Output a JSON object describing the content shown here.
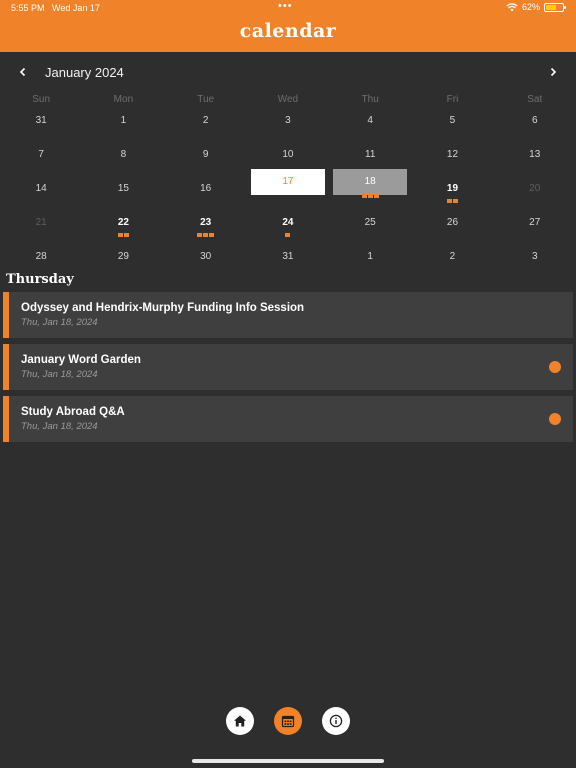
{
  "status": {
    "time": "5:55 PM",
    "date": "Wed Jan 17",
    "dots": "•••",
    "battery": "62%"
  },
  "app": {
    "title": "calendar"
  },
  "month_nav": {
    "label": "January 2024",
    "prev_icon": "chevron-left-icon",
    "next_icon": "chevron-right-icon"
  },
  "weekdays": [
    "Sun",
    "Mon",
    "Tue",
    "Wed",
    "Thu",
    "Fri",
    "Sat"
  ],
  "weeks": [
    [
      {
        "d": "31",
        "state": "normal",
        "dots": 0
      },
      {
        "d": "1",
        "state": "normal",
        "dots": 0
      },
      {
        "d": "2",
        "state": "normal",
        "dots": 0
      },
      {
        "d": "3",
        "state": "normal",
        "dots": 0
      },
      {
        "d": "4",
        "state": "normal",
        "dots": 0
      },
      {
        "d": "5",
        "state": "normal",
        "dots": 0
      },
      {
        "d": "6",
        "state": "normal",
        "dots": 0
      }
    ],
    [
      {
        "d": "7",
        "state": "normal",
        "dots": 0
      },
      {
        "d": "8",
        "state": "normal",
        "dots": 0
      },
      {
        "d": "9",
        "state": "normal",
        "dots": 0
      },
      {
        "d": "10",
        "state": "normal",
        "dots": 0
      },
      {
        "d": "11",
        "state": "normal",
        "dots": 0
      },
      {
        "d": "12",
        "state": "normal",
        "dots": 0
      },
      {
        "d": "13",
        "state": "normal",
        "dots": 0
      }
    ],
    [
      {
        "d": "14",
        "state": "normal",
        "dots": 0
      },
      {
        "d": "15",
        "state": "normal",
        "dots": 0
      },
      {
        "d": "16",
        "state": "normal",
        "dots": 0
      },
      {
        "d": "17",
        "state": "today",
        "dots": 0
      },
      {
        "d": "18",
        "state": "selected",
        "dots": 3
      },
      {
        "d": "19",
        "state": "bold",
        "dots": 2
      },
      {
        "d": "20",
        "state": "muted",
        "dots": 0
      }
    ],
    [
      {
        "d": "21",
        "state": "muted",
        "dots": 0
      },
      {
        "d": "22",
        "state": "bold",
        "dots": 2
      },
      {
        "d": "23",
        "state": "bold",
        "dots": 3
      },
      {
        "d": "24",
        "state": "bold",
        "dots": 1
      },
      {
        "d": "25",
        "state": "normal",
        "dots": 0
      },
      {
        "d": "26",
        "state": "normal",
        "dots": 0
      },
      {
        "d": "27",
        "state": "normal",
        "dots": 0
      }
    ],
    [
      {
        "d": "28",
        "state": "normal",
        "dots": 0
      },
      {
        "d": "29",
        "state": "normal",
        "dots": 0
      },
      {
        "d": "30",
        "state": "normal",
        "dots": 0
      },
      {
        "d": "31",
        "state": "normal",
        "dots": 0
      },
      {
        "d": "1",
        "state": "normal",
        "dots": 0
      },
      {
        "d": "2",
        "state": "normal",
        "dots": 0
      },
      {
        "d": "3",
        "state": "normal",
        "dots": 0
      }
    ]
  ],
  "selected_day": {
    "title": "Thursday"
  },
  "events": [
    {
      "title": "Odyssey and Hendrix-Murphy Funding Info Session",
      "date": "Thu, Jan 18, 2024",
      "has_dot": false
    },
    {
      "title": "January Word Garden",
      "date": "Thu, Jan 18, 2024",
      "has_dot": true
    },
    {
      "title": "Study Abroad Q&A",
      "date": "Thu, Jan 18, 2024",
      "has_dot": true
    }
  ],
  "bottom_nav": [
    {
      "name": "home",
      "icon": "home-icon",
      "active": false
    },
    {
      "name": "calendar",
      "icon": "calendar-icon",
      "active": true
    },
    {
      "name": "info",
      "icon": "info-icon",
      "active": false
    }
  ],
  "colors": {
    "accent": "#f0832a",
    "background": "#2e2e2e",
    "card": "#3f3f3f"
  }
}
